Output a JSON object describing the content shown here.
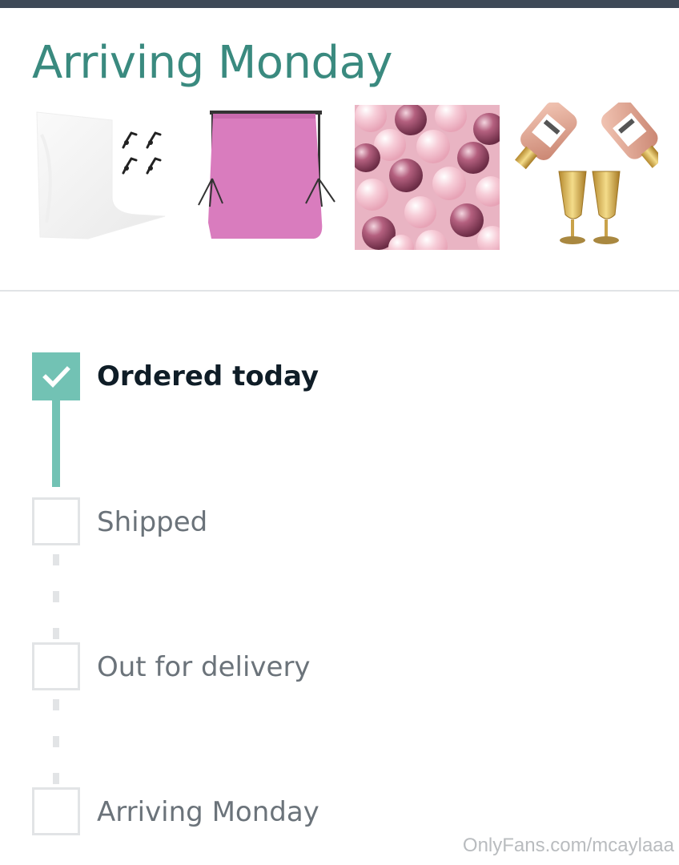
{
  "header": {
    "title": "Arriving Monday"
  },
  "products": [
    {
      "icon": "white-backdrop-image"
    },
    {
      "icon": "pink-backdrop-stand-image"
    },
    {
      "icon": "pink-balloons-image"
    },
    {
      "icon": "champagne-balloons-image"
    }
  ],
  "timeline": {
    "steps": [
      {
        "label": "Ordered today",
        "status": "done",
        "icon": "check-icon"
      },
      {
        "label": "Shipped",
        "status": "pending"
      },
      {
        "label": "Out for delivery",
        "status": "pending"
      },
      {
        "label": "Arriving Monday",
        "status": "pending"
      }
    ]
  },
  "watermark": "OnlyFans.com/mcaylaaa",
  "colors": {
    "accent": "#3a8a7f",
    "progress": "#72c2b4",
    "pending": "#e2e4e6",
    "top_bar": "#3e4957"
  }
}
